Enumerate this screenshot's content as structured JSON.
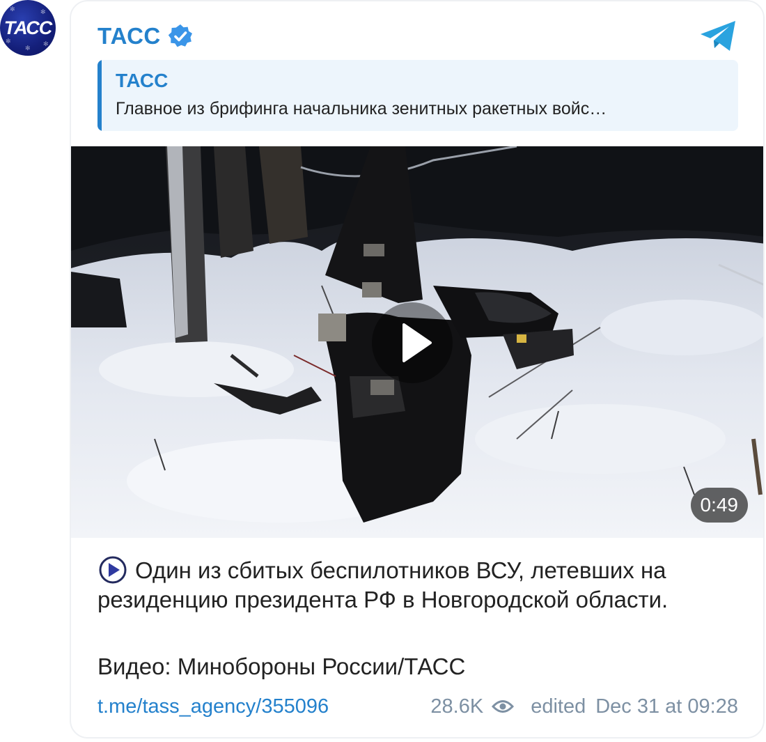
{
  "avatar": {
    "logo_text": "ТАСС",
    "icon": "tass-logo-avatar"
  },
  "channel": {
    "name": "ТАСС",
    "verified_icon": "verified-badge-icon",
    "telegram_icon": "telegram-icon"
  },
  "reply": {
    "title": "ТАСС",
    "text": "Главное из брифинга начальника зенитных ракетных войс…"
  },
  "video": {
    "duration": "0:49",
    "play_icon": "play-icon"
  },
  "message": {
    "text": "Один из сбитых беспилотников ВСУ, летевших на резиденцию президента РФ в Новгородской области.",
    "credit": "Видео: Минобороны России/ТАСС"
  },
  "footer": {
    "link": "t.me/tass_agency/355096",
    "views": "28.6K",
    "edited_label": "edited",
    "date": "Dec 31 at 09:28"
  },
  "colors": {
    "accent": "#2481cc",
    "meta": "#7d90a3",
    "reply_bg": "#edf5fc",
    "avatar_bg": "#141f7a"
  }
}
